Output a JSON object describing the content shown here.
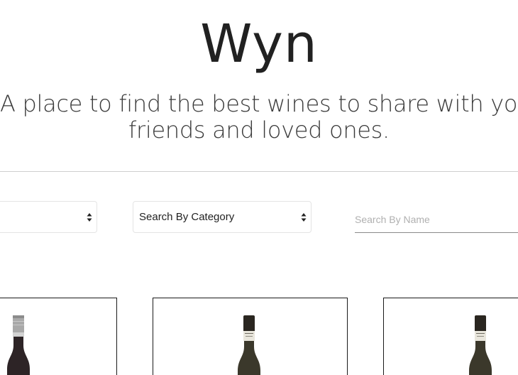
{
  "header": {
    "title": "Wyn",
    "tagline_line1": "A place to find the best wines to share with your",
    "tagline_line2": "friends and loved ones."
  },
  "filters": {
    "left_select_value": "",
    "category_select_value": "Search By Category",
    "search_placeholder": "Search By Name",
    "search_value": ""
  },
  "products": [
    {
      "name": "",
      "capsule": "silver-screwcap-icon"
    },
    {
      "name": "",
      "capsule": "dark-capsule-icon"
    },
    {
      "name": "",
      "capsule": "dark-capsule-icon"
    }
  ],
  "colors": {
    "text": "#212121",
    "divider": "#cfcfcf",
    "card_border": "#1a1a1a",
    "placeholder": "#b0b0b0"
  }
}
